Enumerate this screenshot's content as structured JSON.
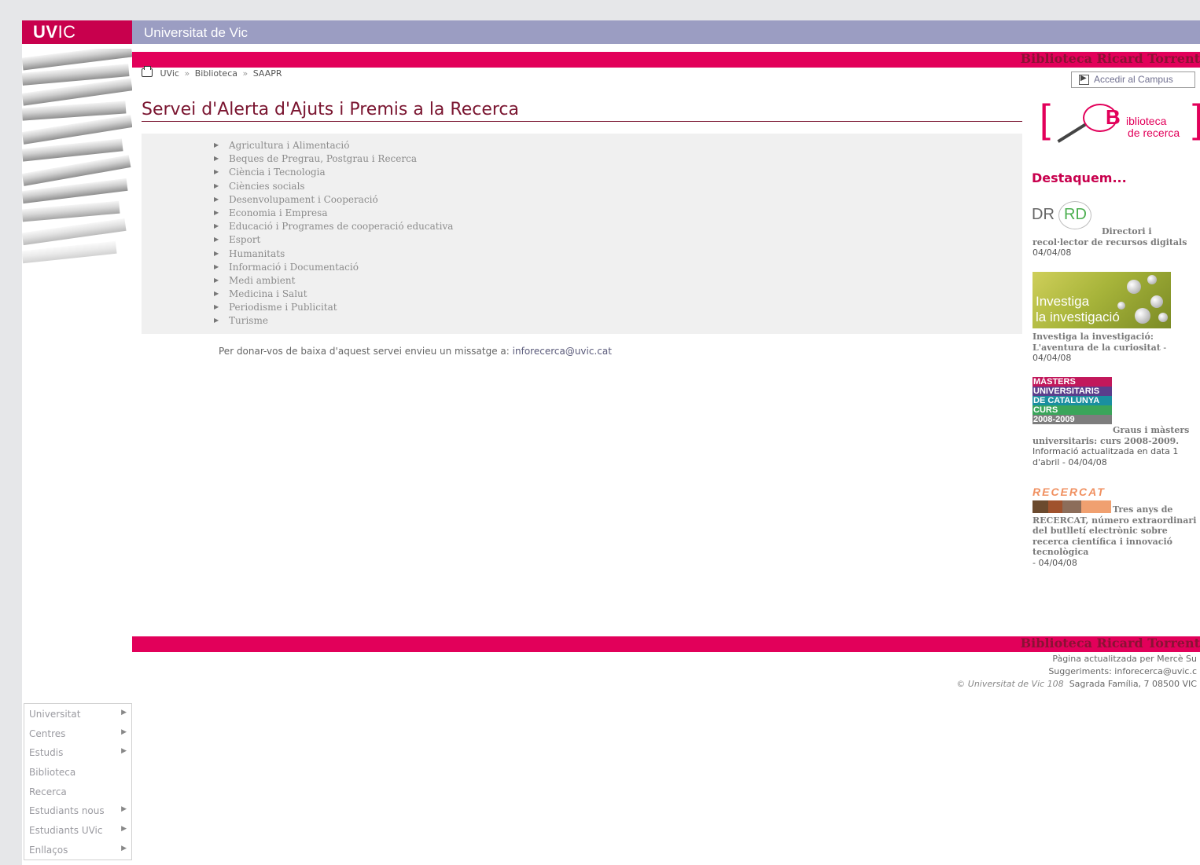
{
  "header": {
    "logo_bold": "UV",
    "logo_light": "IC",
    "university": "Universitat de Vic",
    "section_title": "Biblioteca Ricard Torrent"
  },
  "breadcrumb": {
    "print_icon": "printer-icon",
    "items": [
      "UVic",
      "Biblioteca",
      "SAAPR"
    ],
    "separator": "»"
  },
  "campus_button": {
    "label": "Accedir al Campus",
    "icon": "login-arrow-icon"
  },
  "page_title": "Servei d'Alerta d'Ajuts i Premis a la Recerca",
  "categories": [
    "Agricultura i Alimentació",
    "Beques de Pregrau, Postgrau i Recerca",
    "Ciència i Tecnologia",
    "Ciències socials",
    "Desenvolupament i Cooperació",
    "Economia i Empresa",
    "Educació i Programes de cooperació educativa",
    "Esport",
    "Humanitats",
    "Informació i Documentació",
    "Medi ambient",
    "Medicina i Salut",
    "Periodisme i Publicitat",
    "Turisme"
  ],
  "unsubscribe": {
    "text": "Per donar-vos de baixa d'aquest servei envieu un missatge a:",
    "email": "inforecerca@uvic.cat"
  },
  "right": {
    "biblio_logo": {
      "bracket_left": "[",
      "bracket_right": "]",
      "big_letter": "B",
      "line1": "iblioteca",
      "line2": "de recerca"
    },
    "destaquem": "Destaquem...",
    "news": [
      {
        "logo_dr": "DR",
        "logo_rd": "RD",
        "title_a": "Directori i",
        "title_b": "recol·lector de recursos digitals",
        "date": "04/04/08"
      },
      {
        "img_line1": "Investiga",
        "img_line2": "la investigació",
        "title": "Investiga la investigació: L'aventura de la curiositat",
        "date": "- 04/04/08"
      },
      {
        "img_rows": [
          "MÀSTERS",
          "UNIVERSITARIS",
          "DE CATALUNYA",
          "CURS",
          "2008-2009"
        ],
        "title": "Graus i màsters universitaris: curs 2008-2009.",
        "text": "Informació actualitzada en data 1 d'abril",
        "date": "- 04/04/08"
      },
      {
        "img_label": "RECERCAT",
        "title": "Tres anys de RECERCAT, número extraordinari del butlletí electrònic sobre recerca científica i innovació tecnològica",
        "date": "- 04/04/08"
      }
    ]
  },
  "footer": {
    "title": "Biblioteca Ricard Torrent",
    "updated": "Pàgina actualitzada per Mercè Su",
    "suggestions": "Suggeriments: inforecerca@uvic.c",
    "copyright": "© Universitat de Vic 108",
    "address": "Sagrada Família, 7 08500 VIC"
  },
  "left_menu": [
    {
      "label": "Universitat",
      "submenu": true
    },
    {
      "label": "Centres",
      "submenu": true
    },
    {
      "label": "Estudis",
      "submenu": true
    },
    {
      "label": "Biblioteca",
      "submenu": false
    },
    {
      "label": "Recerca",
      "submenu": false
    },
    {
      "label": "Estudiants nous",
      "submenu": true
    },
    {
      "label": "Estudiants UVic",
      "submenu": true
    },
    {
      "label": "Enllaços",
      "submenu": true
    }
  ],
  "colors": {
    "brand_pink": "#e2005a",
    "brand_red": "#c8004d",
    "header_lavender": "#9b9dc2",
    "title_maroon": "#7a1530"
  }
}
